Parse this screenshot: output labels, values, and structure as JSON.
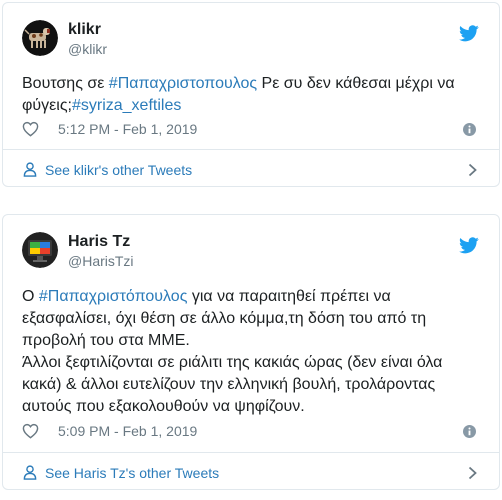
{
  "tweets": [
    {
      "name": "klikr",
      "handle": "@klikr",
      "text_parts": [
        "Βουτσης σε ",
        "#Παπαχριστοπουλος",
        " Ρε συ δεν κάθεσαι μέχρι να\nφύγεις;",
        "#syriza_xeftiles"
      ],
      "timestamp": "5:12 PM - Feb 1, 2019",
      "footer_link": "See klikr's other Tweets"
    },
    {
      "name": "Haris Tz",
      "handle": "@HarisTzi",
      "text_parts": [
        "Ο ",
        "#Παπαχριστόπουλος",
        " για να παραιτηθεί πρέπει να\nεξασφαλίσει, όχι θέση σε άλλο κόμμα,τη δόση του από τη\nπροβολή του στα ΜΜΕ.\nΆλλοι ξεφτιλίζονται σε ριάλιτι της κακιάς ώρας (δεν είναι όλα\nκακά) & άλλοι ευτελίζουν την ελληνική βουλή, τρολάροντας\nαυτούς που εξακολουθούν να ψηφίζουν."
      ],
      "timestamp": "5:09 PM - Feb 1, 2019",
      "footer_link": "See Haris Tz's other Tweets"
    }
  ],
  "icons": {
    "logo": "twitter-bird-icon",
    "like": "heart-icon",
    "info": "info-icon",
    "profile": "person-icon",
    "chevron": "chevron-right-icon"
  },
  "colors": {
    "link": "#2b7bb9",
    "bird": "#1da1f2",
    "muted": "#697882",
    "border": "#e1e8ed",
    "text": "#1c2022"
  }
}
